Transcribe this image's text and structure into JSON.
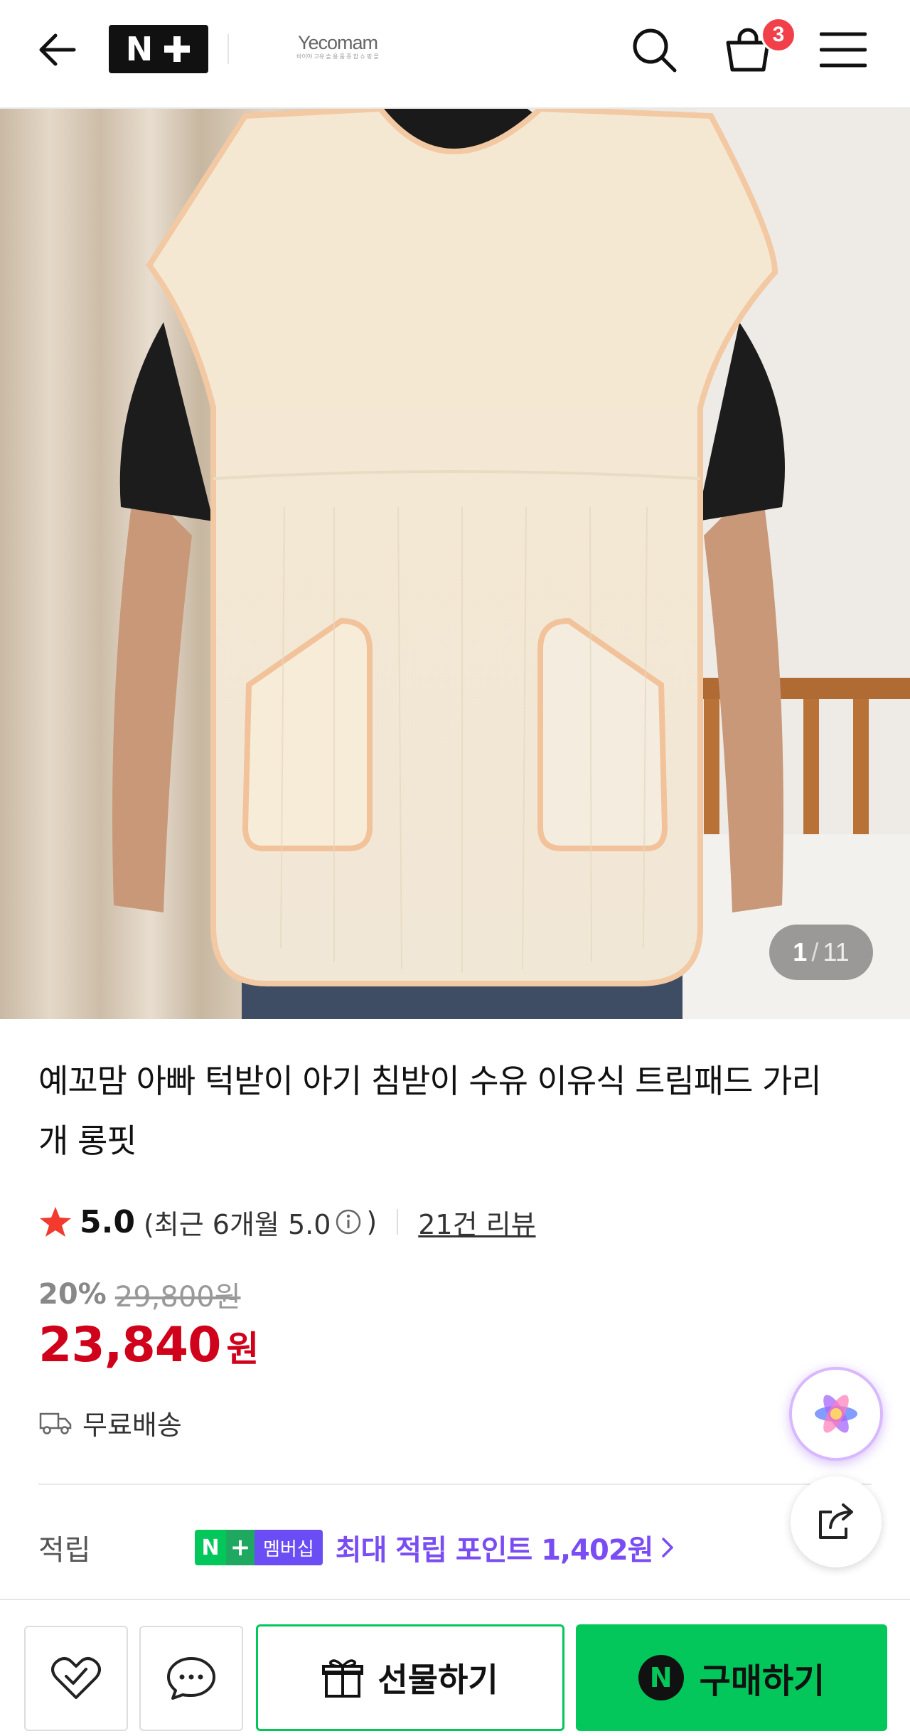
{
  "header": {
    "brand_name": "Yecomam",
    "brand_tagline": "바이야 고유 솔 용 품 종 합 쇼 핑 몰",
    "cart_count": "3"
  },
  "gallery": {
    "current": "1",
    "separator": "/",
    "total": "11"
  },
  "product": {
    "title": "예꼬맘 아빠 턱받이 아기 침받이 수유 이유식 트림패드 가리개 롱핏",
    "rating_score": "5.0",
    "recent_rating_prefix": "(최근 6개월 5.0",
    "recent_rating_suffix": ")",
    "review_link": "21건 리뷰",
    "discount_rate": "20%",
    "original_price": "29,800원",
    "sale_price": "23,840",
    "currency": "원",
    "shipping": "무료배송"
  },
  "points": {
    "label": "적립",
    "badge_n": "N",
    "badge_plus": "+",
    "badge_text": "멤버십",
    "text": "최대 적립 포인트 1,402원"
  },
  "bottom_bar": {
    "gift_label": "선물하기",
    "buy_label": "구매하기",
    "buy_icon_letter": "N"
  },
  "colors": {
    "naver_green": "#03c75a",
    "sale_red": "#d0021b",
    "points_purple": "#7a4cf4",
    "badge_red": "#f2404a"
  },
  "icons": [
    "back-arrow-icon",
    "search-icon",
    "shopping-bag-icon",
    "hamburger-menu-icon",
    "star-icon",
    "info-icon",
    "truck-icon",
    "chevron-right-icon",
    "ai-sparkle-icon",
    "share-icon",
    "heart-check-icon",
    "chat-bubble-icon",
    "gift-icon"
  ]
}
